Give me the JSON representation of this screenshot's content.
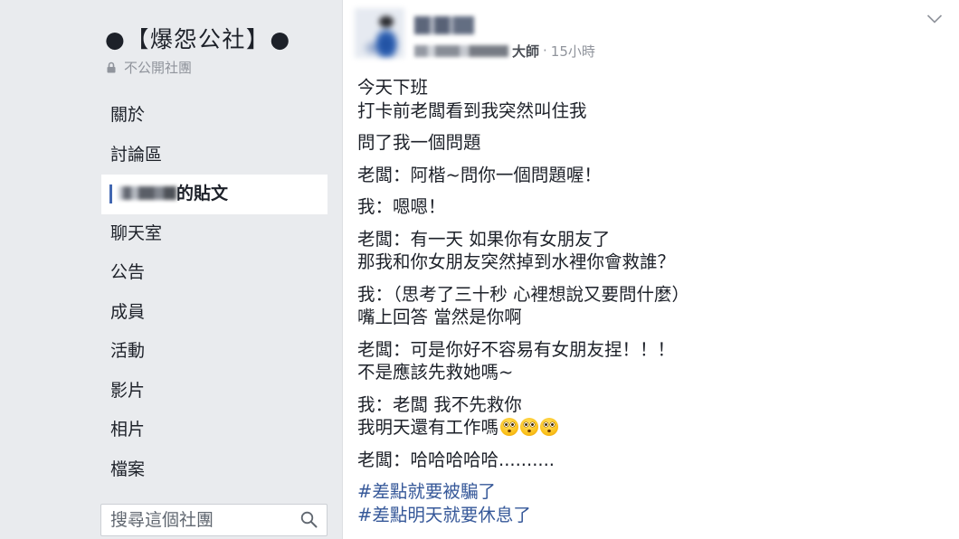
{
  "sidebar": {
    "group_name": "●【爆怨公社】●",
    "privacy_label": "不公開社團",
    "nav": [
      {
        "label": "關於",
        "selected": false
      },
      {
        "label": "討論區",
        "selected": false
      },
      {
        "label": "的貼文",
        "selected": true
      },
      {
        "label": "聊天室",
        "selected": false
      },
      {
        "label": "公告",
        "selected": false
      },
      {
        "label": "成員",
        "selected": false
      },
      {
        "label": "活動",
        "selected": false
      },
      {
        "label": "影片",
        "selected": false
      },
      {
        "label": "相片",
        "selected": false
      },
      {
        "label": "檔案",
        "selected": false
      }
    ],
    "search_placeholder": "搜尋這個社團"
  },
  "post": {
    "author_role_suffix": "大師",
    "meta_separator": "·",
    "timestamp": "15小時",
    "paragraphs": [
      [
        "今天下班",
        "打卡前老闆看到我突然叫住我"
      ],
      [
        "問了我一個問題"
      ],
      [
        "老闆：阿楷~問你一個問題喔！"
      ],
      [
        "我：嗯嗯！"
      ],
      [
        "老闆：有一天 如果你有女朋友了",
        "那我和你女朋友突然掉到水裡你會救誰？"
      ],
      [
        "我：（思考了三十秒 心裡想說又要問什麼）",
        "嘴上回答 當然是你啊"
      ],
      [
        "老闆：可是你好不容易有女朋友捏！！！",
        "不是應該先救她嗎~"
      ],
      [
        "我：老闆 我不先救你",
        "我明天還有工作嗎"
      ],
      [
        "老闆：哈哈哈哈哈.........."
      ]
    ],
    "line_emoji": [
      "flushed-face-icon",
      "flushed-face-icon",
      "flushed-face-icon"
    ],
    "hashtags": [
      "#差點就要被騙了",
      "#差點明天就要休息了"
    ]
  },
  "icons": {
    "privacy": "lock-icon",
    "search": "search-icon",
    "post_menu": "chevron-down-icon",
    "emoji": "flushed-face-icon"
  },
  "colors": {
    "sidebar_bg": "#e9ebee",
    "card_bg": "#ffffff",
    "border": "#dddfe2",
    "text": "#1d2129",
    "muted": "#90949c",
    "secondary": "#606770",
    "link": "#365899",
    "accent": "#4267b2"
  }
}
